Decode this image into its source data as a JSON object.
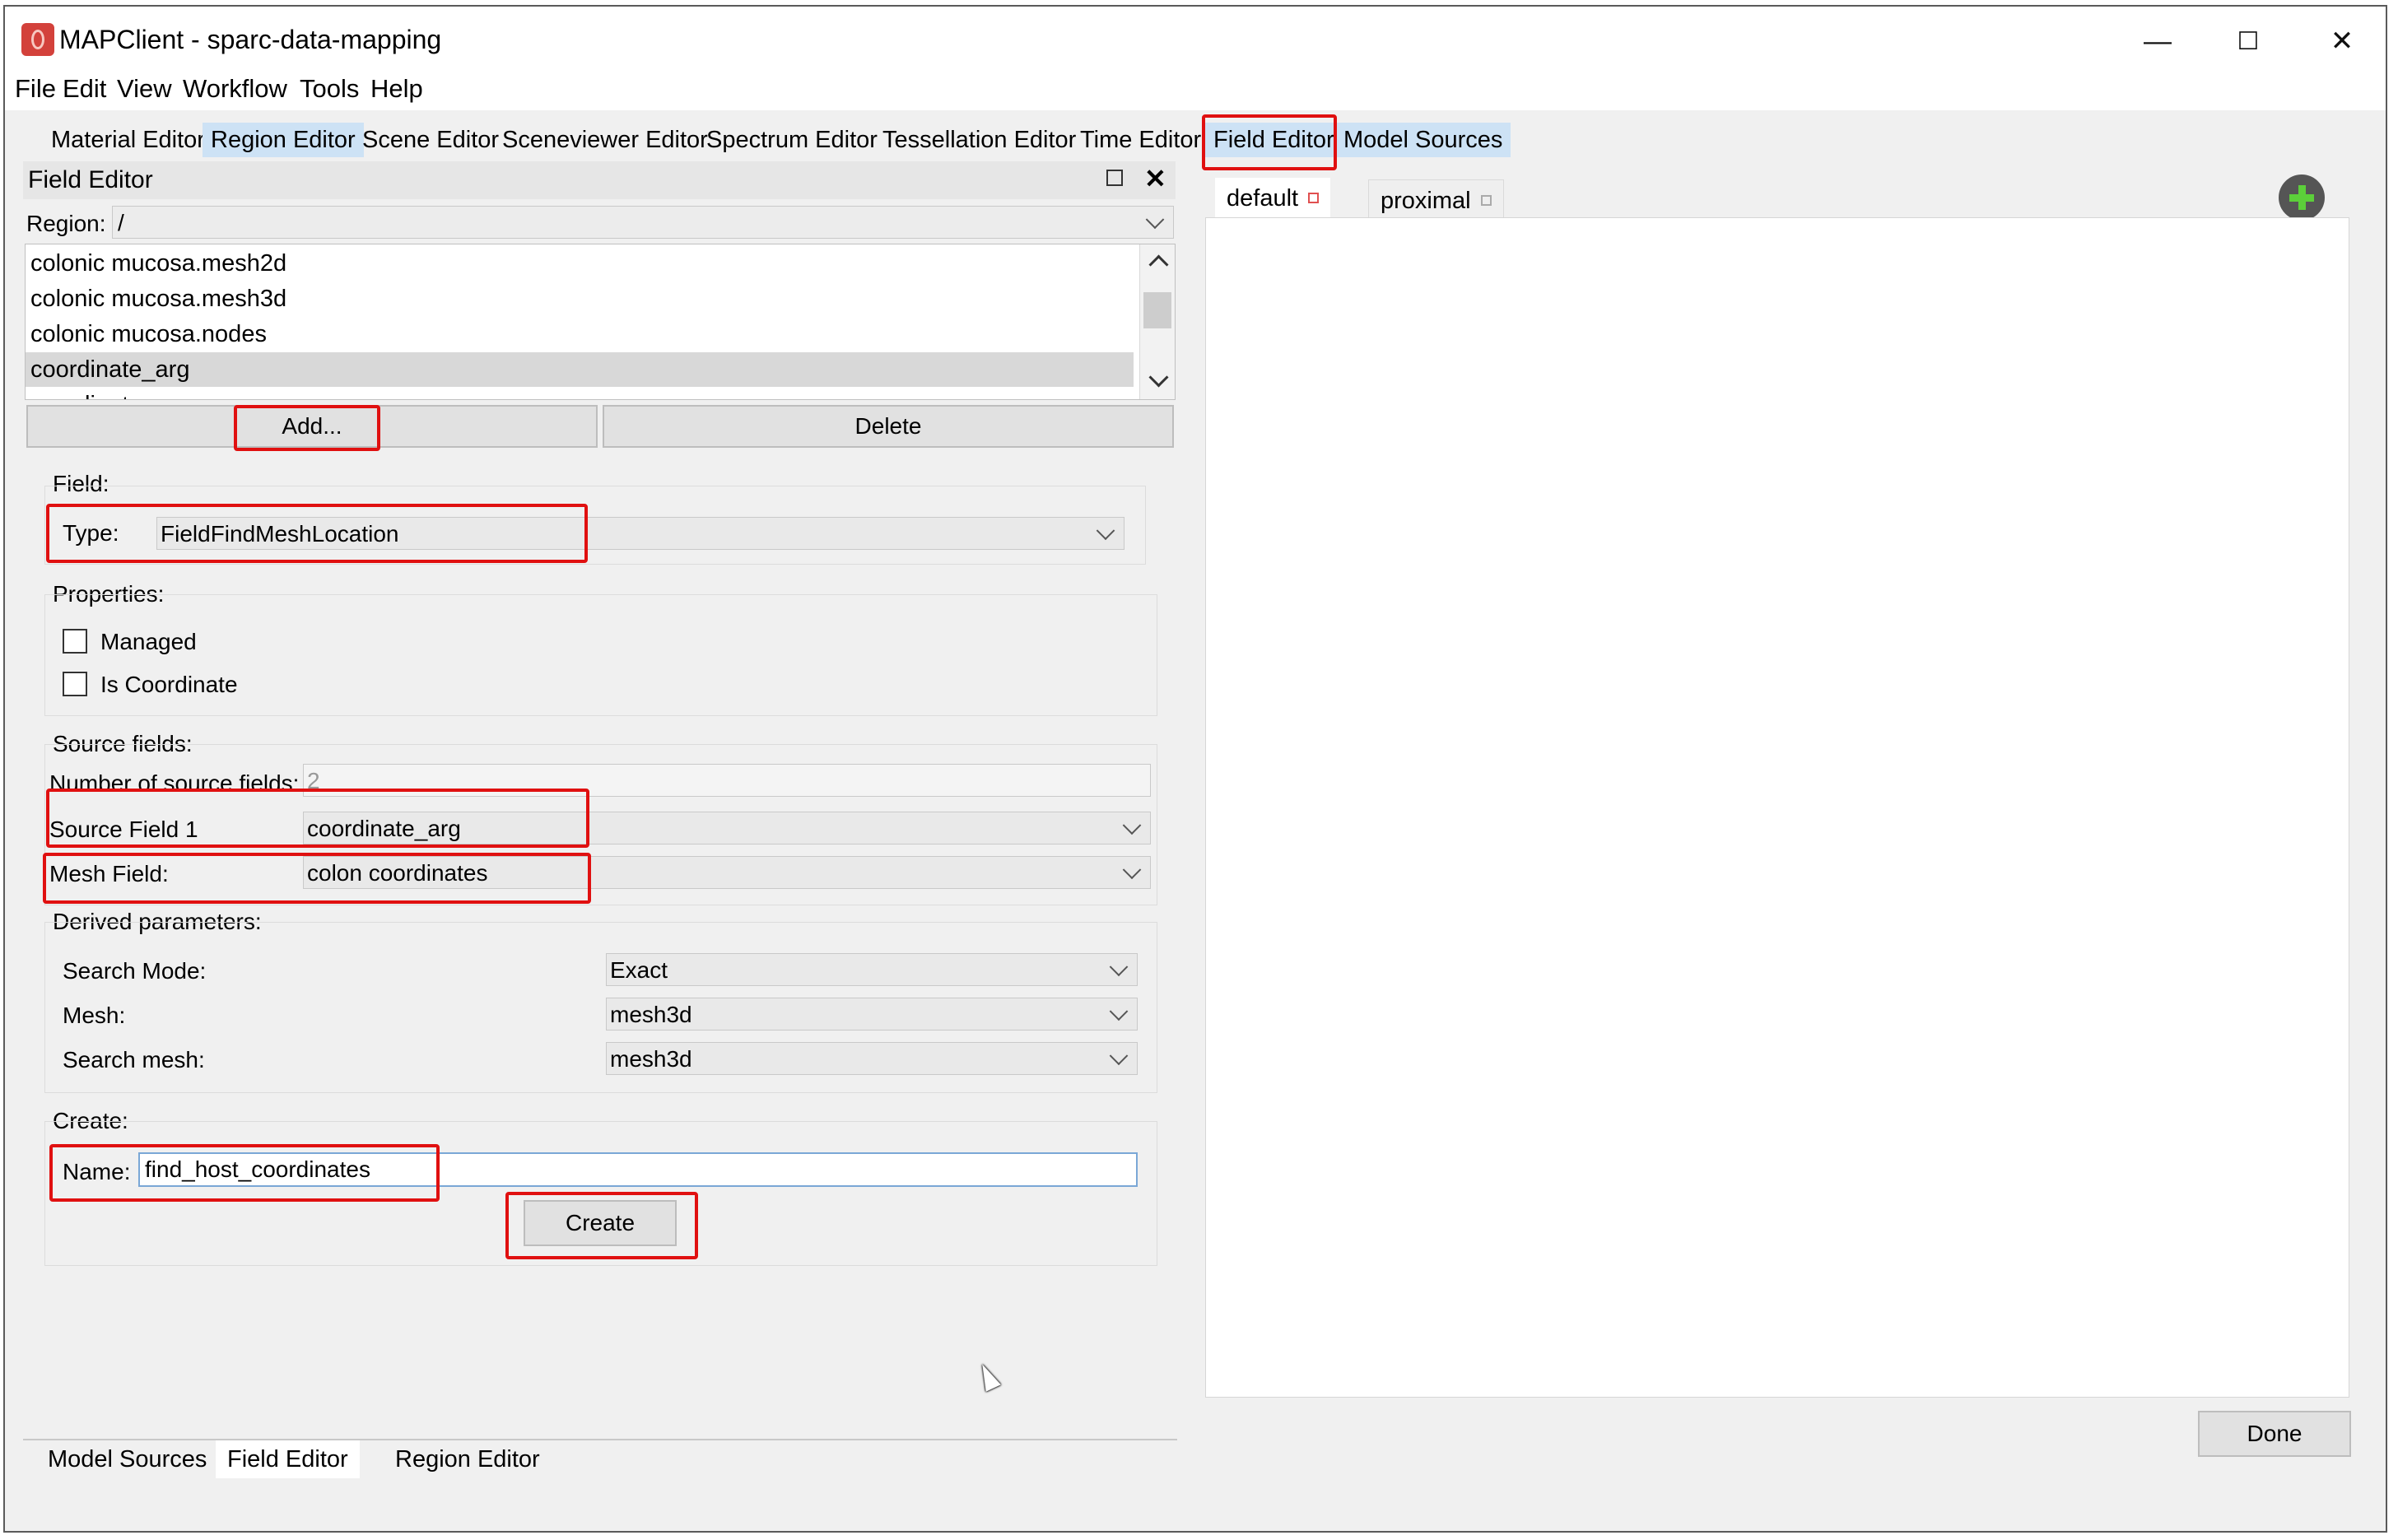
{
  "window": {
    "title": "MAPClient - sparc-data-mapping",
    "controls": {
      "minimize": "—",
      "maximize": "☐",
      "close": "✕"
    }
  },
  "menu": [
    "File",
    "Edit",
    "View",
    "Workflow",
    "Tools",
    "Help"
  ],
  "toolbar_tabs": [
    "Material Editor",
    "Region Editor",
    "Scene Editor",
    "Sceneviewer Editor",
    "Spectrum Editor",
    "Tessellation Editor",
    "Time Editor",
    "Field Editor",
    "Model Sources"
  ],
  "dock": {
    "title": "Field Editor",
    "region_label": "Region:",
    "region_value": "/",
    "field_list": [
      "colonic mucosa.mesh2d",
      "colonic mucosa.mesh3d",
      "colonic mucosa.nodes",
      "coordinate_arg",
      "coordinates"
    ],
    "add_label": "Add...",
    "delete_label": "Delete",
    "field_group": "Field:",
    "type_label": "Type:",
    "type_value": "FieldFindMeshLocation",
    "properties_group": "Properties:",
    "managed_label": "Managed",
    "is_coordinate_label": "Is Coordinate",
    "source_group": "Source fields:",
    "num_source_label": "Number of source fields:",
    "num_source_value": "2",
    "source_field_label": "Source Field 1",
    "source_field_value": "coordinate_arg",
    "mesh_field_label": "Mesh Field:",
    "mesh_field_value": "colon coordinates",
    "derived_group": "Derived parameters:",
    "search_mode_label": "Search Mode:",
    "search_mode_value": "Exact",
    "mesh_label": "Mesh:",
    "mesh_value": "mesh3d",
    "search_mesh_label": "Search mesh:",
    "search_mesh_value": "mesh3d",
    "create_group": "Create:",
    "name_label": "Name:",
    "name_value": "find_host_coordinates",
    "create_label": "Create"
  },
  "scene_tabs": [
    "default",
    "proximal"
  ],
  "done_label": "Done",
  "bottom_tabs": [
    "Model Sources",
    "Field Editor",
    "Region Editor"
  ],
  "colors": {
    "accent_tab": "#cde2f5",
    "highlight": "#e01010",
    "close_active": "#e05050"
  }
}
